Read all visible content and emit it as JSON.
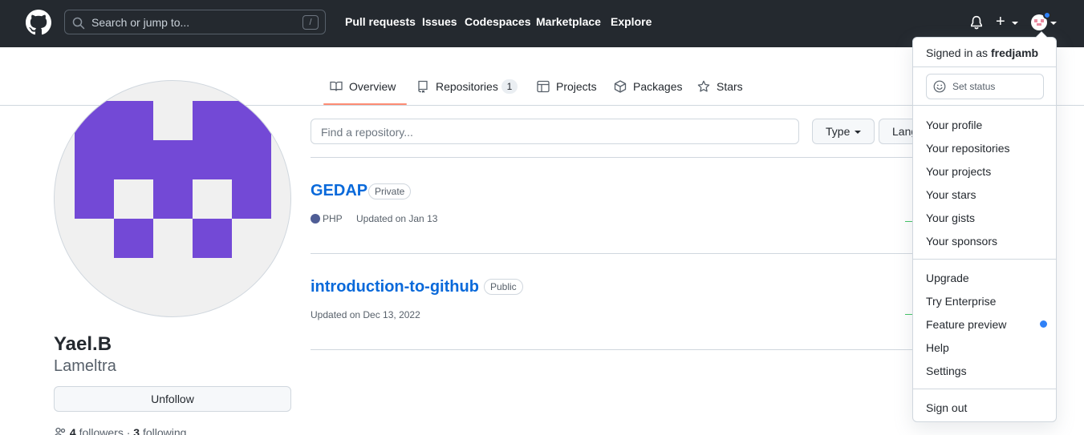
{
  "header": {
    "search_placeholder": "Search or jump to...",
    "search_shortcut": "/",
    "nav": [
      "Pull requests",
      "Issues",
      "Codespaces",
      "Marketplace",
      "Explore"
    ],
    "plus_label": "+"
  },
  "tabs": [
    {
      "label": "Overview",
      "icon": "book-icon",
      "selected": true
    },
    {
      "label": "Repositories",
      "icon": "repo-icon",
      "count": "1"
    },
    {
      "label": "Projects",
      "icon": "table-icon"
    },
    {
      "label": "Packages",
      "icon": "package-icon"
    },
    {
      "label": "Stars",
      "icon": "star-icon"
    }
  ],
  "profile": {
    "name": "Yael.B",
    "login": "Lameltra",
    "unfollow_label": "Unfollow",
    "followers_count": "4",
    "followers_label": "followers",
    "separator": "·",
    "following_count": "3",
    "following_label": "following",
    "avatar_color": "#7349d6"
  },
  "repos_toolbar": {
    "find_placeholder": "Find a repository...",
    "type_label": "Type",
    "language_label": "Language"
  },
  "repositories": [
    {
      "name": "GEDAP",
      "visibility": "Private",
      "language": "PHP",
      "language_color": "#4F5D95",
      "updated": "Updated on Jan 13"
    },
    {
      "name": "introduction-to-github",
      "visibility": "Public",
      "updated": "Updated on Dec 13, 2022"
    }
  ],
  "user_menu": {
    "signed_in_prefix": "Signed in as",
    "username": "fredjamb",
    "set_status": "Set status",
    "group1": [
      "Your profile",
      "Your repositories",
      "Your projects",
      "Your stars",
      "Your gists",
      "Your sponsors"
    ],
    "group2": [
      "Upgrade",
      "Try Enterprise",
      "Feature preview",
      "Help",
      "Settings"
    ],
    "sign_out": "Sign out",
    "accent": "#2f81f7"
  }
}
